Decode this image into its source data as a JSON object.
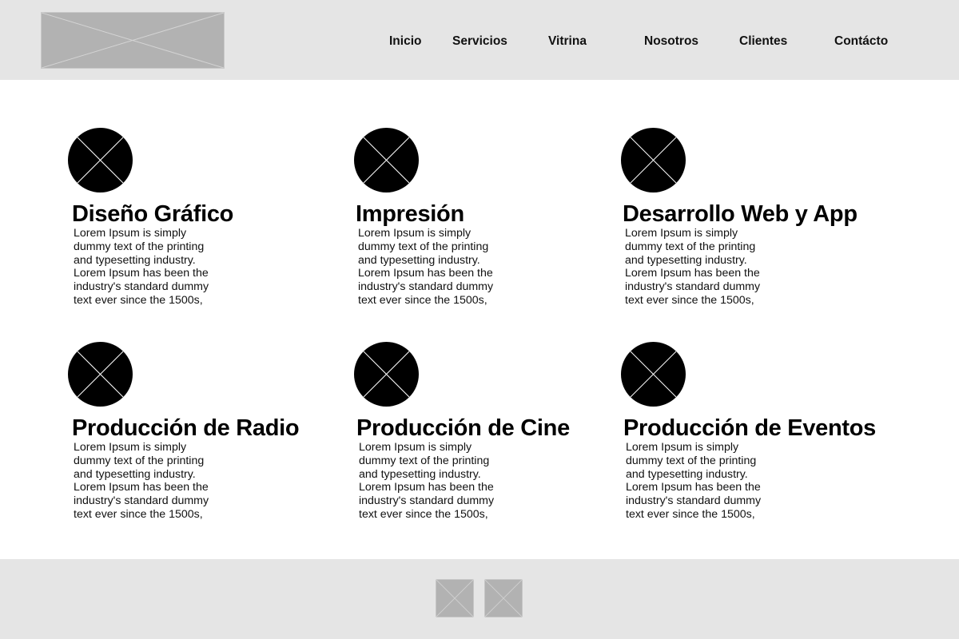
{
  "header": {
    "logo": "logo-placeholder",
    "nav": [
      {
        "label": "Inicio"
      },
      {
        "label": "Servicios"
      },
      {
        "label": "Vitrina"
      },
      {
        "label": "Nosotros"
      },
      {
        "label": "Clientes"
      },
      {
        "label": "Contácto"
      }
    ]
  },
  "services": [
    {
      "icon": "image-placeholder-icon",
      "title": "Diseño Gráfico",
      "text": "Lorem Ipsum is simply dummy text of the printing and typesetting industry. Lorem Ipsum has been the industry's standard dummy text ever since the 1500s,"
    },
    {
      "icon": "image-placeholder-icon",
      "title": "Impresión",
      "text": "Lorem Ipsum is simply dummy text of the printing and typesetting industry. Lorem Ipsum has been the industry's standard dummy text ever since the 1500s,"
    },
    {
      "icon": "image-placeholder-icon",
      "title": "Desarrollo Web y App",
      "text": "Lorem Ipsum is simply dummy text of the printing and typesetting industry. Lorem Ipsum has been the industry's standard dummy text ever since the 1500s,"
    },
    {
      "icon": "image-placeholder-icon",
      "title": "Producción de Radio",
      "text": "Lorem Ipsum is simply dummy text of the printing and typesetting industry. Lorem Ipsum has been the industry's standard dummy text ever since the 1500s,"
    },
    {
      "icon": "image-placeholder-icon",
      "title": "Producción de Cine",
      "text": "Lorem Ipsum is simply dummy text of the printing and typesetting industry. Lorem Ipsum has been the industry's standard dummy text ever since the 1500s,"
    },
    {
      "icon": "image-placeholder-icon",
      "title": "Producción de Eventos",
      "text": "Lorem Ipsum is simply dummy text of the printing and typesetting industry. Lorem Ipsum has been the industry's standard dummy text ever since the 1500s,"
    }
  ],
  "footer": {
    "social": [
      {
        "icon": "social-placeholder-icon"
      },
      {
        "icon": "social-placeholder-icon"
      }
    ]
  },
  "colors": {
    "header_bg": "#e5e5e5",
    "placeholder": "#b2b2b2",
    "icon_fill": "#000000"
  }
}
